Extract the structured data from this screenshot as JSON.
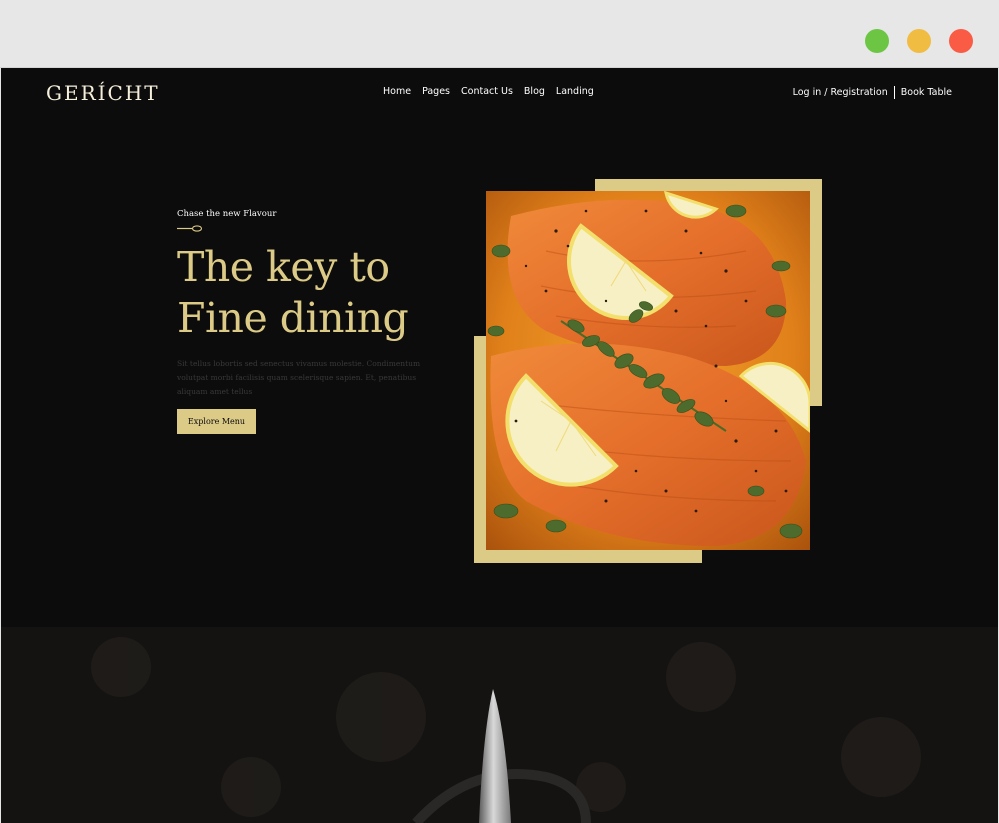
{
  "window": {
    "controls": [
      {
        "name": "green",
        "color": "#6cc644"
      },
      {
        "name": "yellow",
        "color": "#f0bc42"
      },
      {
        "name": "red",
        "color": "#fa5b45"
      }
    ]
  },
  "header": {
    "logo": "GERÍCHT",
    "nav": [
      "Home",
      "Pages",
      "Contact Us",
      "Blog",
      "Landing"
    ],
    "login_label": "Log in / Registration",
    "book_label": "Book Table"
  },
  "hero": {
    "subtitle": "Chase the new Flavour",
    "title_line1": "The key to",
    "title_line2": "Fine dining",
    "description": "Sit tellus lobortis sed senectus vivamus molestie. Condimentum volutpat morbi facilisis quam scelerisque sapien. Et, penatibus aliquam amet tellus",
    "cta_label": "Explore Menu"
  },
  "colors": {
    "background": "#0c0c0c",
    "accent_gold": "#dcca87",
    "text_white": "#ffffff",
    "muted_text": "#393939"
  },
  "icons": {
    "spoon": "spoon-icon",
    "knife": "knife-icon"
  }
}
